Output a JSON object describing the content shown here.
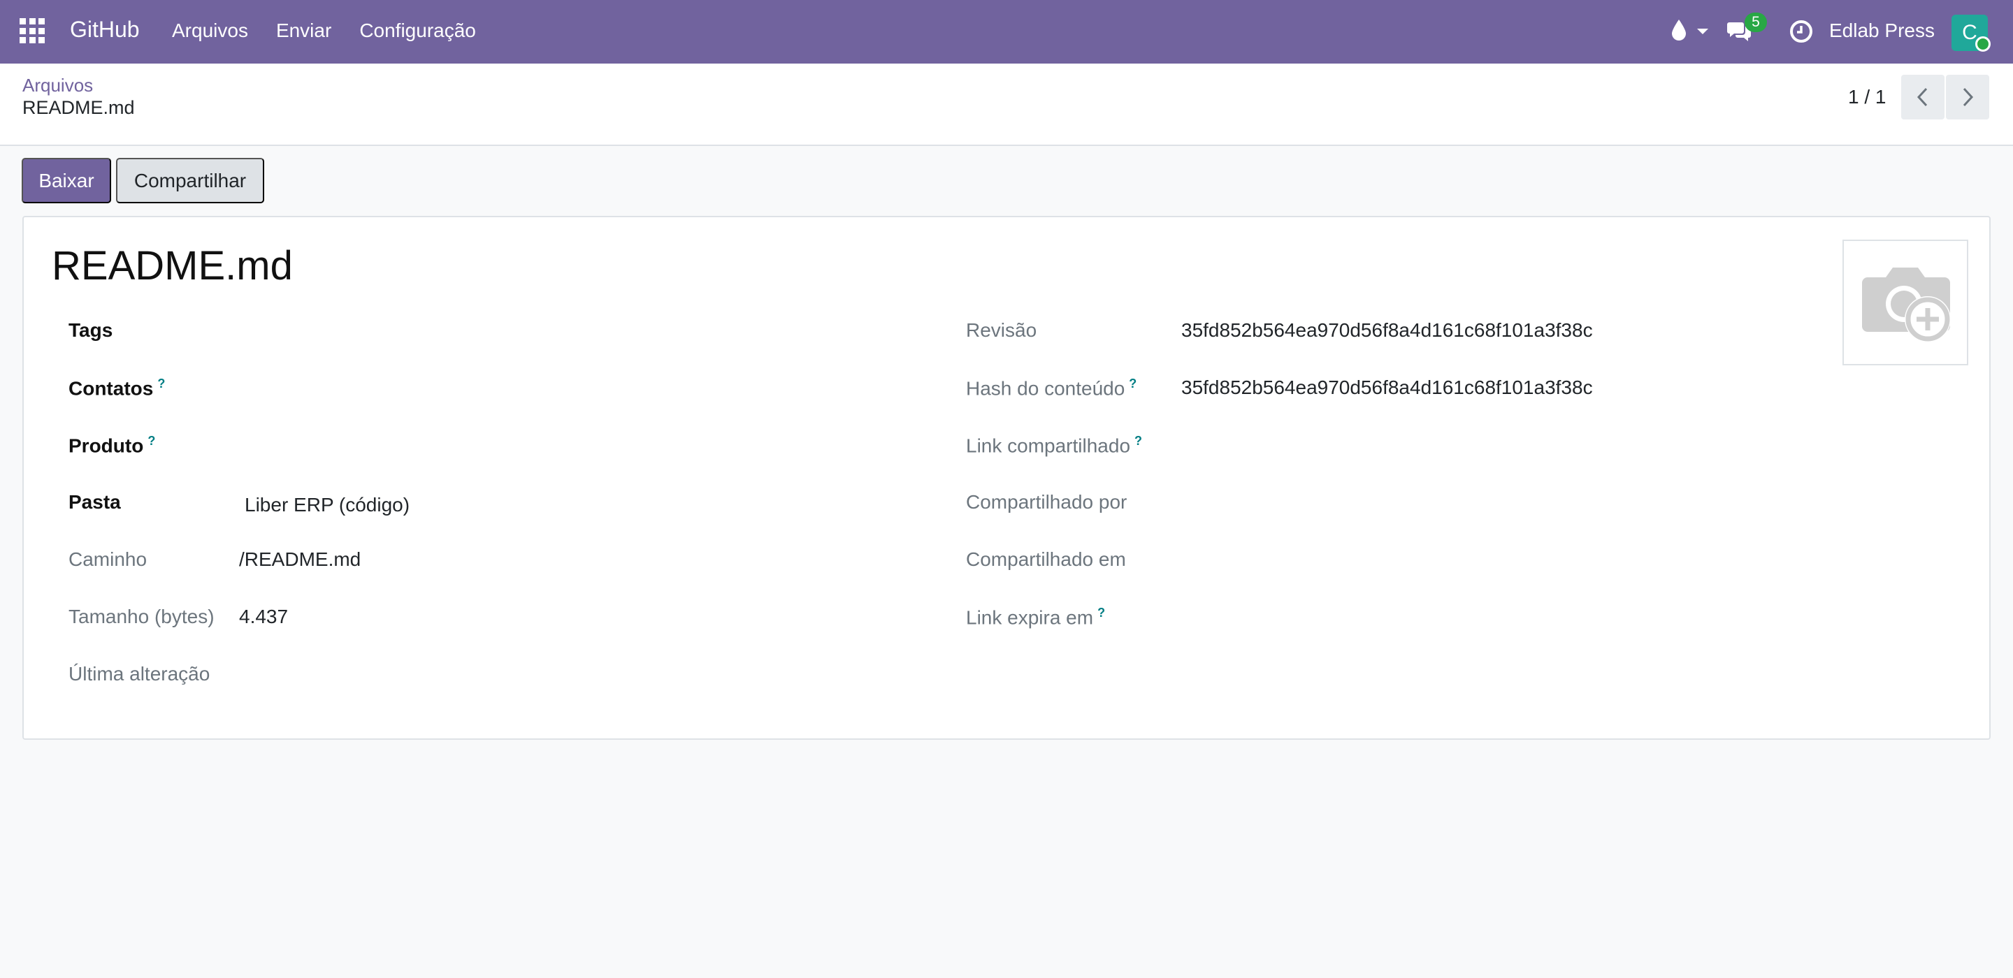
{
  "navbar": {
    "brand": "GitHub",
    "menu": [
      "Arquivos",
      "Enviar",
      "Configuração"
    ],
    "chat_count": "5",
    "user_name": "Edlab Press",
    "avatar_initial": "C",
    "accent_color": "#71639e"
  },
  "breadcrumb": {
    "parent": "Arquivos",
    "current": "README.md"
  },
  "pager": {
    "value": "1 / 1"
  },
  "actions": {
    "download": "Baixar",
    "share": "Compartilhar"
  },
  "record": {
    "title": "README.md",
    "left_fields": {
      "tags_label": "Tags",
      "contacts_label": "Contatos",
      "product_label": "Produto",
      "folder_label": "Pasta",
      "folder_value": "Liber ERP (código)",
      "path_label": "Caminho",
      "path_value": "/README.md",
      "size_label": "Tamanho (bytes)",
      "size_value": "4.437",
      "last_change_label": "Última alteração"
    },
    "right_fields": {
      "revision_label": "Revisão",
      "revision_value": "35fd852b564ea970d56f8a4d161c68f101a3f38c",
      "hash_label": "Hash do conteúdo",
      "hash_value": "35fd852b564ea970d56f8a4d161c68f101a3f38c",
      "shared_link_label": "Link compartilhado",
      "shared_by_label": "Compartilhado por",
      "shared_on_label": "Compartilhado em",
      "link_expires_label": "Link expira em"
    },
    "help_mark": "?"
  }
}
